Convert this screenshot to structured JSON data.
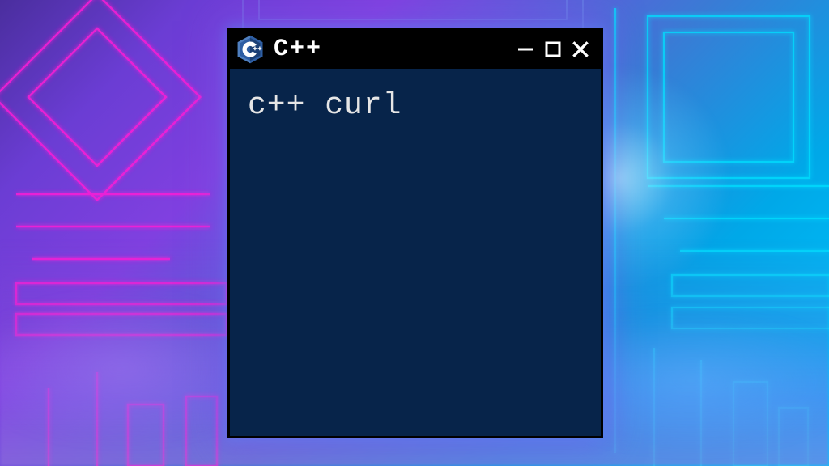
{
  "window": {
    "title": "C++",
    "icon_name": "cpp-logo",
    "controls": {
      "minimize": "minimize",
      "maximize": "maximize",
      "close": "close"
    }
  },
  "terminal": {
    "content": "c++ curl",
    "bg_color": "#07244a",
    "text_color": "#e6e6e6"
  },
  "background": {
    "accent_magenta": "#ff1fd6",
    "accent_cyan": "#00e0ff"
  }
}
